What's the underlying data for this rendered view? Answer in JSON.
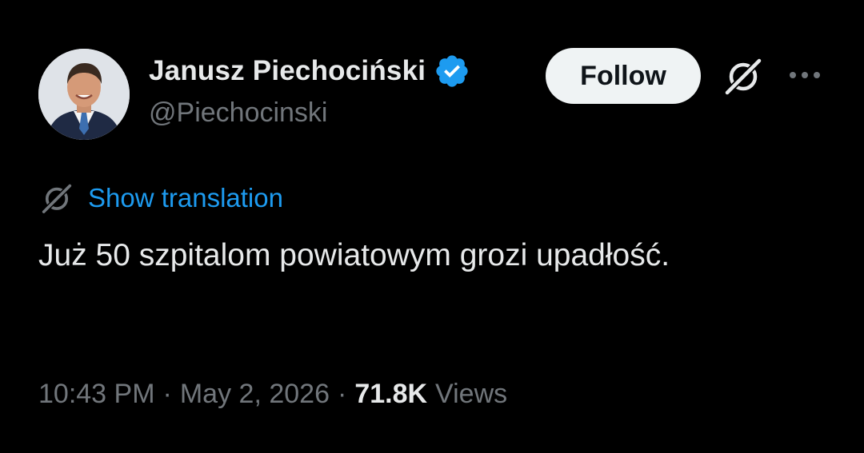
{
  "author": {
    "display_name": "Janusz Piechociński",
    "handle": "@Piechocinski",
    "verified_icon": "verified-badge-icon"
  },
  "actions": {
    "follow_label": "Follow",
    "grok_icon": "grok-icon",
    "more_icon": "more-icon"
  },
  "translation": {
    "icon": "translate-icon",
    "label": "Show translation"
  },
  "tweet": {
    "text": "Już 50 szpitalom powiatowym grozi upadłość."
  },
  "meta": {
    "time": "10:43 PM",
    "separator": "·",
    "date": "May 2, 2026",
    "views_count": "71.8K",
    "views_label": "Views"
  },
  "colors": {
    "background": "#000000",
    "primary_text": "#e7e9ea",
    "secondary_text": "#71767b",
    "link": "#1d9bf0",
    "verified": "#1d9bf0",
    "follow_bg": "#eff3f4",
    "follow_text": "#0f1419"
  }
}
